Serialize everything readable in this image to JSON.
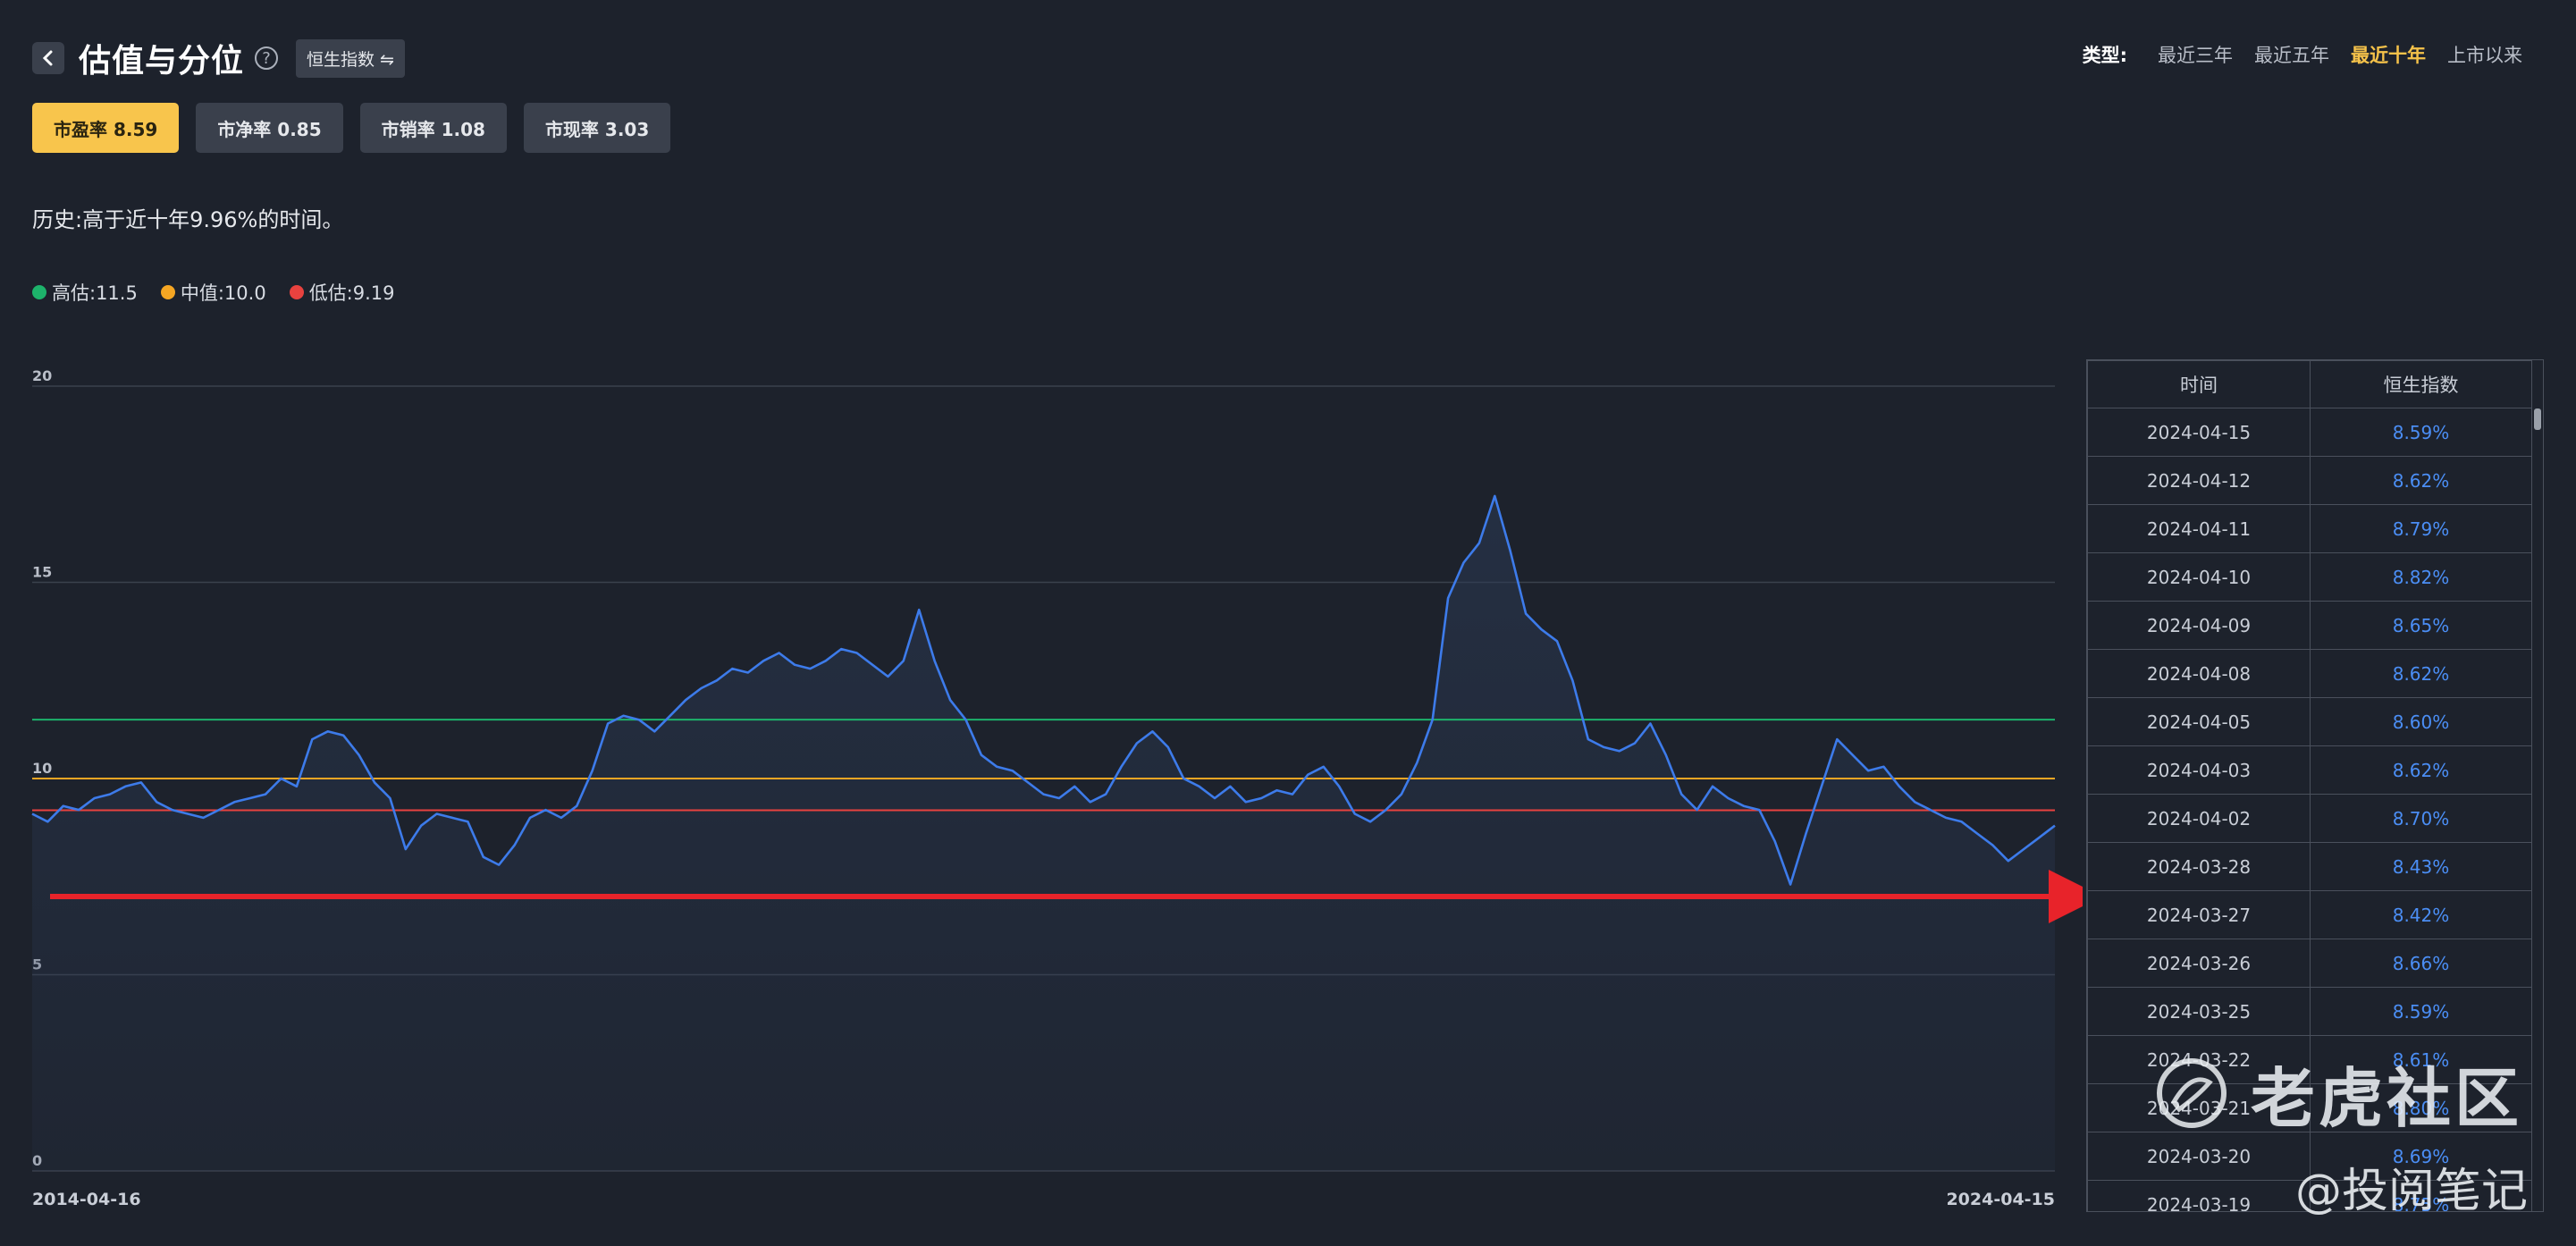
{
  "header": {
    "title": "估值与分位",
    "index_switch": "恒生指数 ⇋"
  },
  "period": {
    "label": "类型:",
    "options": [
      "最近三年",
      "最近五年",
      "最近十年",
      "上市以来"
    ],
    "active": "最近十年"
  },
  "tabs": [
    {
      "label": "市盈率 8.59",
      "active": true
    },
    {
      "label": "市净率 0.85",
      "active": false
    },
    {
      "label": "市销率 1.08",
      "active": false
    },
    {
      "label": "市现率 3.03",
      "active": false
    }
  ],
  "history_text": "历史:高于近十年9.96%的时间。",
  "legend": [
    {
      "label": "高估:11.5",
      "color": "#1db36b"
    },
    {
      "label": "中值:10.0",
      "color": "#f5a623"
    },
    {
      "label": "低估:9.19",
      "color": "#e8423f"
    }
  ],
  "chart_data": {
    "type": "line",
    "series": [
      {
        "values": [
          9.1,
          8.9,
          9.3,
          9.2,
          9.5,
          9.6,
          9.8,
          9.9,
          9.4,
          9.2,
          9.1,
          9.0,
          9.2,
          9.4,
          9.5,
          9.6,
          10.0,
          9.8,
          11.0,
          11.2,
          11.1,
          10.6,
          9.9,
          9.5,
          8.2,
          8.8,
          9.1,
          9.0,
          8.9,
          8.0,
          7.8,
          8.3,
          9.0,
          9.2,
          9.0,
          9.3,
          10.2,
          11.4,
          11.6,
          11.5,
          11.2,
          11.6,
          12.0,
          12.3,
          12.5,
          12.8,
          12.7,
          13.0,
          13.2,
          12.9,
          12.8,
          13.0,
          13.3,
          13.2,
          12.9,
          12.6,
          13.0,
          14.3,
          13.0,
          12.0,
          11.5,
          10.6,
          10.3,
          10.2,
          9.9,
          9.6,
          9.5,
          9.8,
          9.4,
          9.6,
          10.3,
          10.9,
          11.2,
          10.8,
          10.0,
          9.8,
          9.5,
          9.8,
          9.4,
          9.5,
          9.7,
          9.6,
          10.1,
          10.3,
          9.8,
          9.1,
          8.9,
          9.2,
          9.6,
          10.4,
          11.5,
          14.6,
          15.5,
          16.0,
          17.2,
          15.8,
          14.2,
          13.8,
          13.5,
          12.5,
          11.0,
          10.8,
          10.7,
          10.9,
          11.4,
          10.6,
          9.6,
          9.2,
          9.8,
          9.5,
          9.3,
          9.2,
          8.4,
          7.3,
          8.6,
          9.8,
          11.0,
          10.6,
          10.2,
          10.3,
          9.8,
          9.4,
          9.2,
          9.0,
          8.9,
          8.6,
          8.3,
          7.9,
          8.2,
          8.5,
          8.8
        ]
      }
    ],
    "x_start_label": "2014-04-16",
    "x_end_label": "2024-04-15",
    "y_ticks": [
      0,
      5,
      10,
      15,
      20
    ],
    "ylim": [
      0,
      20
    ],
    "reference_lines": [
      {
        "value": 11.5,
        "color": "#1db36b"
      },
      {
        "value": 10.0,
        "color": "#f5a623"
      },
      {
        "value": 9.19,
        "color": "#e8423f"
      }
    ],
    "line_color": "#3d7bea",
    "grid": true
  },
  "table": {
    "headers": [
      "时间",
      "恒生指数"
    ],
    "rows": [
      [
        "2024-04-15",
        "8.59%"
      ],
      [
        "2024-04-12",
        "8.62%"
      ],
      [
        "2024-04-11",
        "8.79%"
      ],
      [
        "2024-04-10",
        "8.82%"
      ],
      [
        "2024-04-09",
        "8.65%"
      ],
      [
        "2024-04-08",
        "8.62%"
      ],
      [
        "2024-04-05",
        "8.60%"
      ],
      [
        "2024-04-03",
        "8.62%"
      ],
      [
        "2024-04-02",
        "8.70%"
      ],
      [
        "2024-03-28",
        "8.43%"
      ],
      [
        "2024-03-27",
        "8.42%"
      ],
      [
        "2024-03-26",
        "8.66%"
      ],
      [
        "2024-03-25",
        "8.59%"
      ],
      [
        "2024-03-22",
        "8.61%"
      ],
      [
        "2024-03-21",
        "8.80%"
      ],
      [
        "2024-03-20",
        "8.69%"
      ],
      [
        "2024-03-19",
        "8.75%"
      ]
    ]
  },
  "watermark": {
    "brand": "老虎社区",
    "author": "@投阅笔记"
  }
}
